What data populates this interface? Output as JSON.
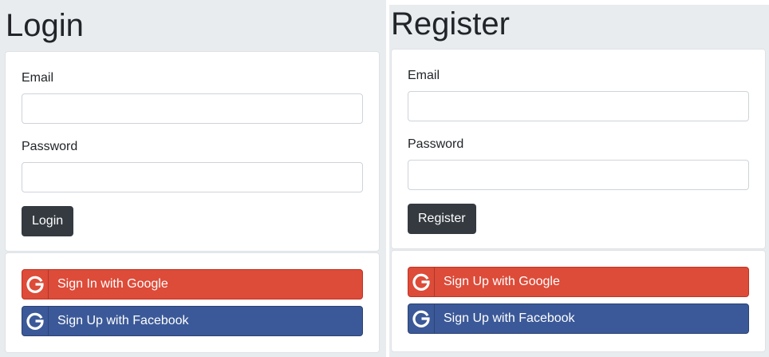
{
  "login": {
    "title": "Login",
    "email_label": "Email",
    "password_label": "Password",
    "submit_label": "Login",
    "google_label": "Sign In with Google",
    "facebook_label": "Sign Up with Facebook"
  },
  "register": {
    "title": "Register",
    "email_label": "Email",
    "password_label": "Password",
    "submit_label": "Register",
    "google_label": "Sign Up with Google",
    "facebook_label": "Sign Up with Facebook"
  },
  "colors": {
    "google": "#dd4b39",
    "facebook": "#3b5998",
    "dark_button": "#343a40",
    "background": "#e9ecef"
  },
  "icons": {
    "social": "google-g-icon"
  }
}
